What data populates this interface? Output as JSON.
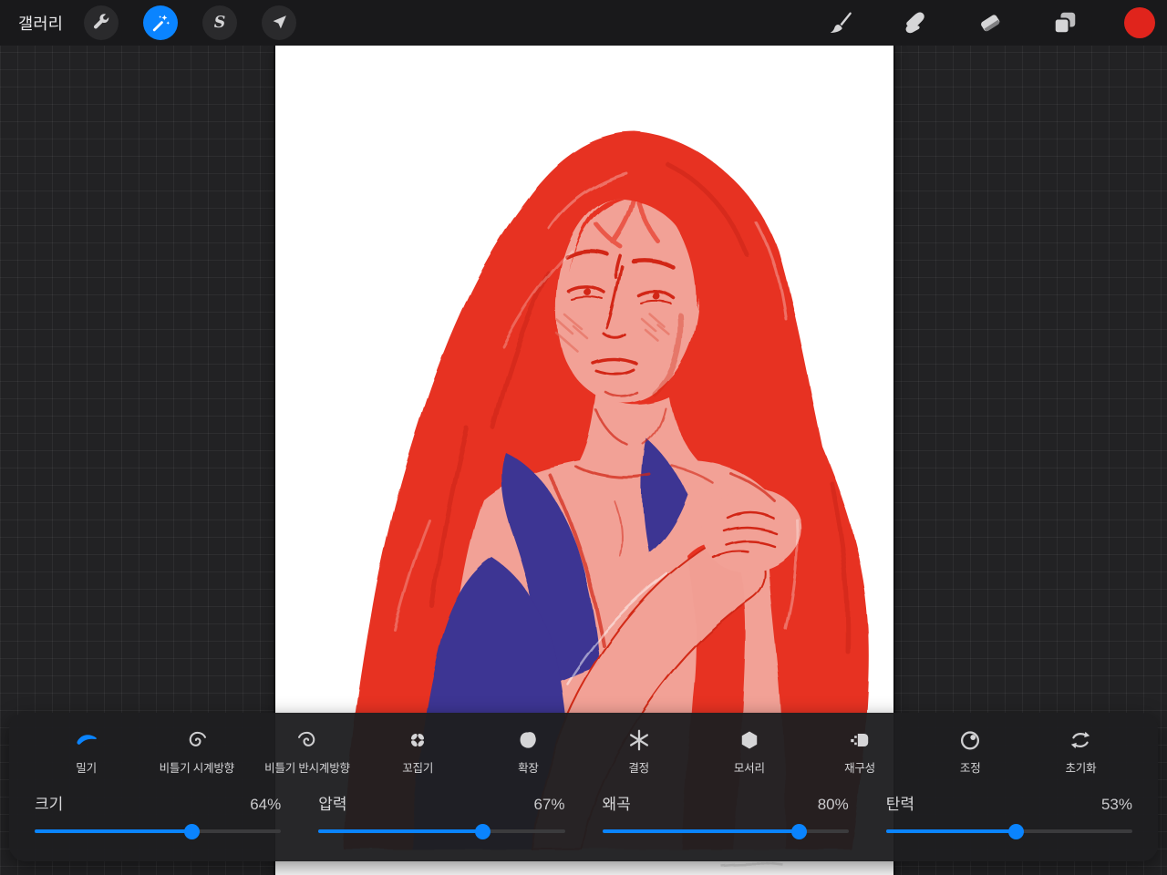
{
  "colors": {
    "accent": "#0a84ff",
    "current_color": "#e0241c",
    "canvas_bg": "#ffffff",
    "artwork_red": "#e73323",
    "artwork_red_line": "#d22817",
    "artwork_skin": "#f2a196",
    "artwork_blush": "#e4695a",
    "artwork_blue": "#3d3493"
  },
  "topbar": {
    "gallery_label": "갤러리",
    "selection_letter": "S",
    "left_tools": [
      {
        "id": "actions",
        "icon": "wrench-icon",
        "active": false
      },
      {
        "id": "adjustments",
        "icon": "magic-wand-icon",
        "active": true
      },
      {
        "id": "selection",
        "icon": "selection-s-icon",
        "active": false
      },
      {
        "id": "transform",
        "icon": "transform-arrow-icon",
        "active": false
      }
    ],
    "right_tools": [
      {
        "id": "brush",
        "icon": "brush-icon"
      },
      {
        "id": "smudge",
        "icon": "smudge-icon"
      },
      {
        "id": "erase",
        "icon": "eraser-icon"
      },
      {
        "id": "layers",
        "icon": "layers-icon"
      },
      {
        "id": "color",
        "icon": "color-swatch"
      }
    ]
  },
  "liquify": {
    "modes": [
      {
        "label": "밀기",
        "icon": "push-swoosh-icon",
        "active": true
      },
      {
        "label": "비틀기 시계방향",
        "icon": "twirl-clockwise-icon",
        "active": false
      },
      {
        "label": "비틀기 반시계방향",
        "icon": "twirl-counterclockwise-icon",
        "active": false
      },
      {
        "label": "꼬집기",
        "icon": "pinch-icon",
        "active": false
      },
      {
        "label": "확장",
        "icon": "expand-icon",
        "active": false
      },
      {
        "label": "결정",
        "icon": "crystal-icon",
        "active": false
      },
      {
        "label": "모서리",
        "icon": "edge-icon",
        "active": false
      },
      {
        "label": "재구성",
        "icon": "reconstruct-icon",
        "active": false
      },
      {
        "label": "조정",
        "icon": "adjust-icon",
        "active": false
      },
      {
        "label": "초기화",
        "icon": "reset-icon",
        "active": false
      }
    ],
    "sliders": [
      {
        "label": "크기",
        "value": "64%",
        "percent": 64
      },
      {
        "label": "압력",
        "value": "67%",
        "percent": 67
      },
      {
        "label": "왜곡",
        "value": "80%",
        "percent": 80
      },
      {
        "label": "탄력",
        "value": "53%",
        "percent": 53
      }
    ]
  }
}
